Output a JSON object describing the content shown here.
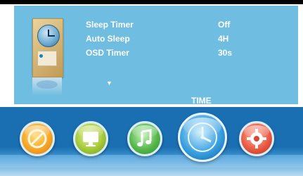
{
  "menu": {
    "settings": [
      {
        "label": "Sleep Timer",
        "value": "Off"
      },
      {
        "label": "Auto Sleep",
        "value": "4H"
      },
      {
        "label": "OSD Timer",
        "value": "30s"
      }
    ],
    "scroll_hint": "▼",
    "section_title": "TIME"
  },
  "dock": {
    "items": [
      {
        "icon": "picture-icon",
        "selected": false
      },
      {
        "icon": "monitor-icon",
        "selected": false
      },
      {
        "icon": "music-note-icon",
        "selected": false
      },
      {
        "icon": "clock-icon",
        "selected": true
      },
      {
        "icon": "gear-icon",
        "selected": false
      }
    ]
  },
  "colors": {
    "panel": "#6fbde0",
    "dock": "#1a6fb3",
    "text": "#ffffff"
  }
}
